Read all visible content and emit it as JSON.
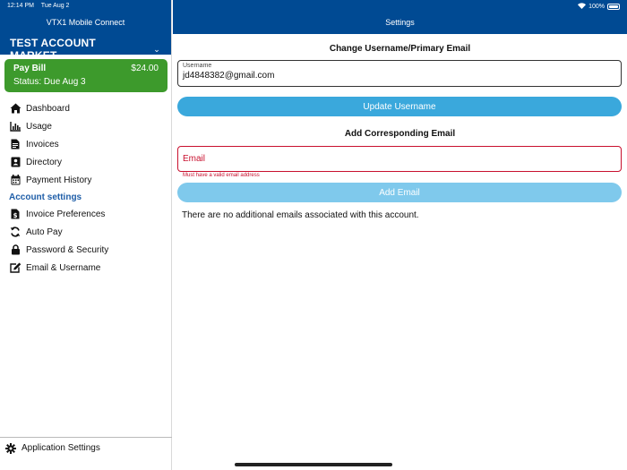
{
  "status_bar": {
    "time": "12:14 PM",
    "date": "Tue Aug 2",
    "battery": "100%"
  },
  "sidebar": {
    "app_title": "VTX1 Mobile Connect",
    "account_name": "TEST ACCOUNT MARKET...",
    "pay_bill": {
      "label": "Pay Bill",
      "amount": "$24.00",
      "status": "Status: Due Aug 3"
    },
    "items": [
      {
        "label": "Dashboard",
        "icon": "home-icon"
      },
      {
        "label": "Usage",
        "icon": "bar-chart-icon"
      },
      {
        "label": "Invoices",
        "icon": "document-icon"
      },
      {
        "label": "Directory",
        "icon": "contact-book-icon"
      },
      {
        "label": "Payment History",
        "icon": "calendar-icon"
      }
    ],
    "account_settings_label": "Account settings",
    "settings_items": [
      {
        "label": "Invoice Preferences",
        "icon": "invoice-dollar-icon"
      },
      {
        "label": "Auto Pay",
        "icon": "sync-icon"
      },
      {
        "label": "Password & Security",
        "icon": "lock-icon"
      },
      {
        "label": "Email & Username",
        "icon": "edit-icon"
      }
    ],
    "application_settings": "Application Settings"
  },
  "main": {
    "title": "Settings",
    "change_username_title": "Change Username/Primary Email",
    "username_field": {
      "label": "Username",
      "value": "jd4848382@gmail.com"
    },
    "update_username_button": "Update Username",
    "add_email_title": "Add Corresponding Email",
    "email_field": {
      "placeholder": "Email",
      "error": "Must have a valid email address"
    },
    "add_email_button": "Add Email",
    "no_emails_text": "There are no additional emails associated with this account."
  },
  "colors": {
    "header_blue": "#004a93",
    "pay_bill_green": "#3d9a2c",
    "button_blue": "#3aa8dc",
    "button_disabled": "#7fc9ec",
    "error_red": "#c8102e",
    "section_blue": "#1f5ea8"
  }
}
